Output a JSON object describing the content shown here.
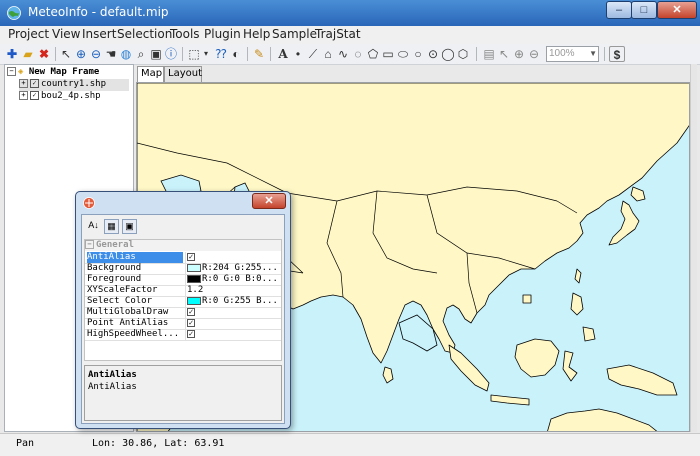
{
  "window": {
    "title": "MeteoInfo - default.mip",
    "minimize": "–",
    "maximize": "□",
    "close": "✕"
  },
  "menu": [
    "Project",
    "View",
    "Insert",
    "Selection",
    "Tools",
    "Plugin",
    "Help",
    "Sample",
    "TrajStat"
  ],
  "toolbar": {
    "zoom_value": "100%"
  },
  "legend": {
    "root": "New Map Frame",
    "layers": [
      "country1.shp",
      "bou2_4p.shp"
    ]
  },
  "tabs": {
    "map": "Map",
    "layout": "Layout"
  },
  "status": {
    "mode": "Pan",
    "coords": "Lon: 30.86, Lat: 63.91"
  },
  "dialog": {
    "close": "✕",
    "category": "General",
    "rows": [
      {
        "name": "AntiAlias",
        "value": "",
        "checked": true,
        "selected": true
      },
      {
        "name": "Background",
        "value": "R:204 G:255...",
        "swatch": "#ccffff"
      },
      {
        "name": "Foreground",
        "value": "R:0 G:0 B:0...",
        "swatch": "#000000"
      },
      {
        "name": "XYScaleFactor",
        "value": "1.2"
      },
      {
        "name": "Select Color",
        "value": "R:0 G:255 B...",
        "swatch": "#00ffff"
      },
      {
        "name": "MultiGlobalDraw",
        "value": "",
        "checked": true
      },
      {
        "name": "Point AntiAlias",
        "value": "",
        "checked": true
      },
      {
        "name": "HighSpeedWheel...",
        "value": "",
        "checked": true
      }
    ],
    "desc_title": "AntiAlias",
    "desc_text": "AntiAlias"
  },
  "colors": {
    "ocean": "#c9f2fb",
    "land": "#fff8c6",
    "selection": "#3d8ee8"
  }
}
